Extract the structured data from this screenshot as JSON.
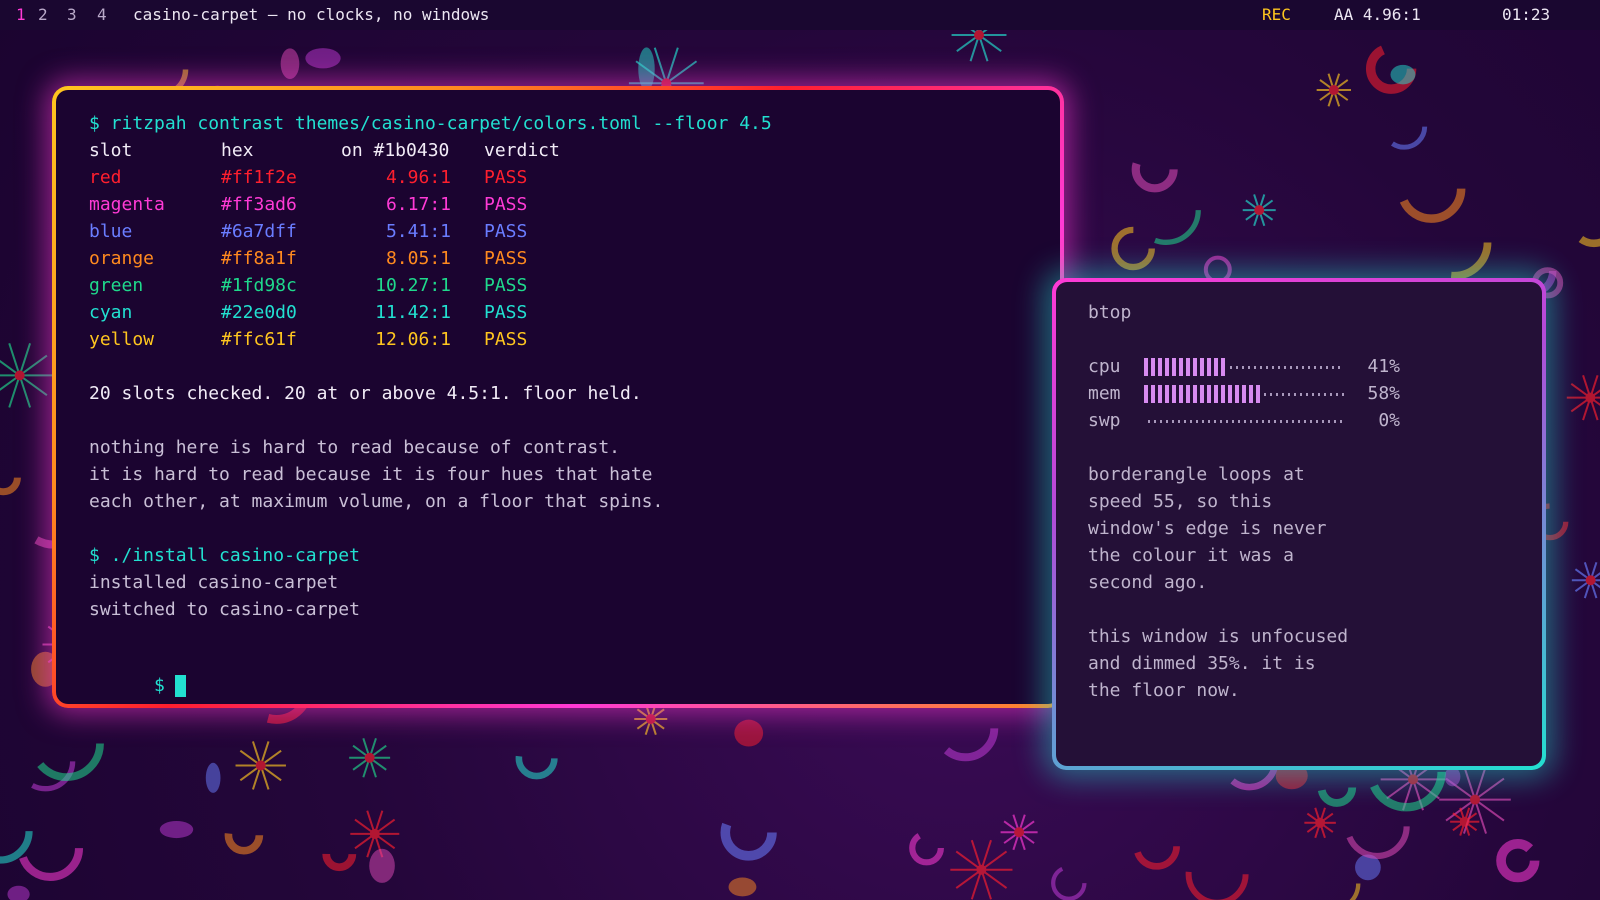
{
  "topbar": {
    "workspaces": [
      "1",
      "2",
      "3",
      "4"
    ],
    "active_workspace": "1",
    "window_title": "casino-carpet — no clocks, no windows",
    "rec": "REC",
    "aa": "AA 4.96:1",
    "clock": "01:23"
  },
  "terminal": {
    "command": "$ ritzpah contrast themes/casino-carpet/colors.toml --floor 4.5",
    "headers": {
      "slot": "slot",
      "hex": "hex",
      "ratio": "on #1b0430",
      "verdict": "verdict"
    },
    "rows": [
      {
        "slot": "red",
        "hex": "#ff1f2e",
        "ratio": "4.96:1",
        "verdict": "PASS",
        "color": "#ff1f2e"
      },
      {
        "slot": "magenta",
        "hex": "#ff3ad6",
        "ratio": "6.17:1",
        "verdict": "PASS",
        "color": "#ff3ad6"
      },
      {
        "slot": "blue",
        "hex": "#6a7dff",
        "ratio": "5.41:1",
        "verdict": "PASS",
        "color": "#6a7dff"
      },
      {
        "slot": "orange",
        "hex": "#ff8a1f",
        "ratio": "8.05:1",
        "verdict": "PASS",
        "color": "#ff8a1f"
      },
      {
        "slot": "green",
        "hex": "#1fd98c",
        "ratio": "10.27:1",
        "verdict": "PASS",
        "color": "#1fd98c"
      },
      {
        "slot": "cyan",
        "hex": "#22e0d0",
        "ratio": "11.42:1",
        "verdict": "PASS",
        "color": "#22e0d0"
      },
      {
        "slot": "yellow",
        "hex": "#ffc61f",
        "ratio": "12.06:1",
        "verdict": "PASS",
        "color": "#ffc61f"
      }
    ],
    "summary": "20 slots checked. 20 at or above 4.5:1. floor held.",
    "note_lines": [
      "nothing here is hard to read because of contrast.",
      "it is hard to read because it is four hues that hate",
      "each other, at maximum volume, on a floor that spins."
    ],
    "install_command": "$ ./install casino-carpet",
    "install_output": [
      "installed casino-carpet",
      "switched to casino-carpet"
    ],
    "prompt": "$"
  },
  "btop": {
    "title": "btop",
    "meters": [
      {
        "label": "cpu",
        "value": 0.41,
        "pct": "41%"
      },
      {
        "label": "mem",
        "value": 0.58,
        "pct": "58%"
      },
      {
        "label": "swp",
        "value": 0.0,
        "pct": "0%"
      }
    ],
    "para1": [
      "borderangle loops at",
      "speed 55, so this",
      "window's edge is never",
      "the colour it was a",
      "second ago."
    ],
    "para2": [
      "this window is unfocused",
      "and dimmed 35%. it is",
      "the floor now."
    ]
  },
  "colors": {
    "background": "#1b0430",
    "accent_cyan": "#22e0d0",
    "accent_magenta": "#ff3ad6",
    "accent_yellow": "#ffc61f"
  }
}
